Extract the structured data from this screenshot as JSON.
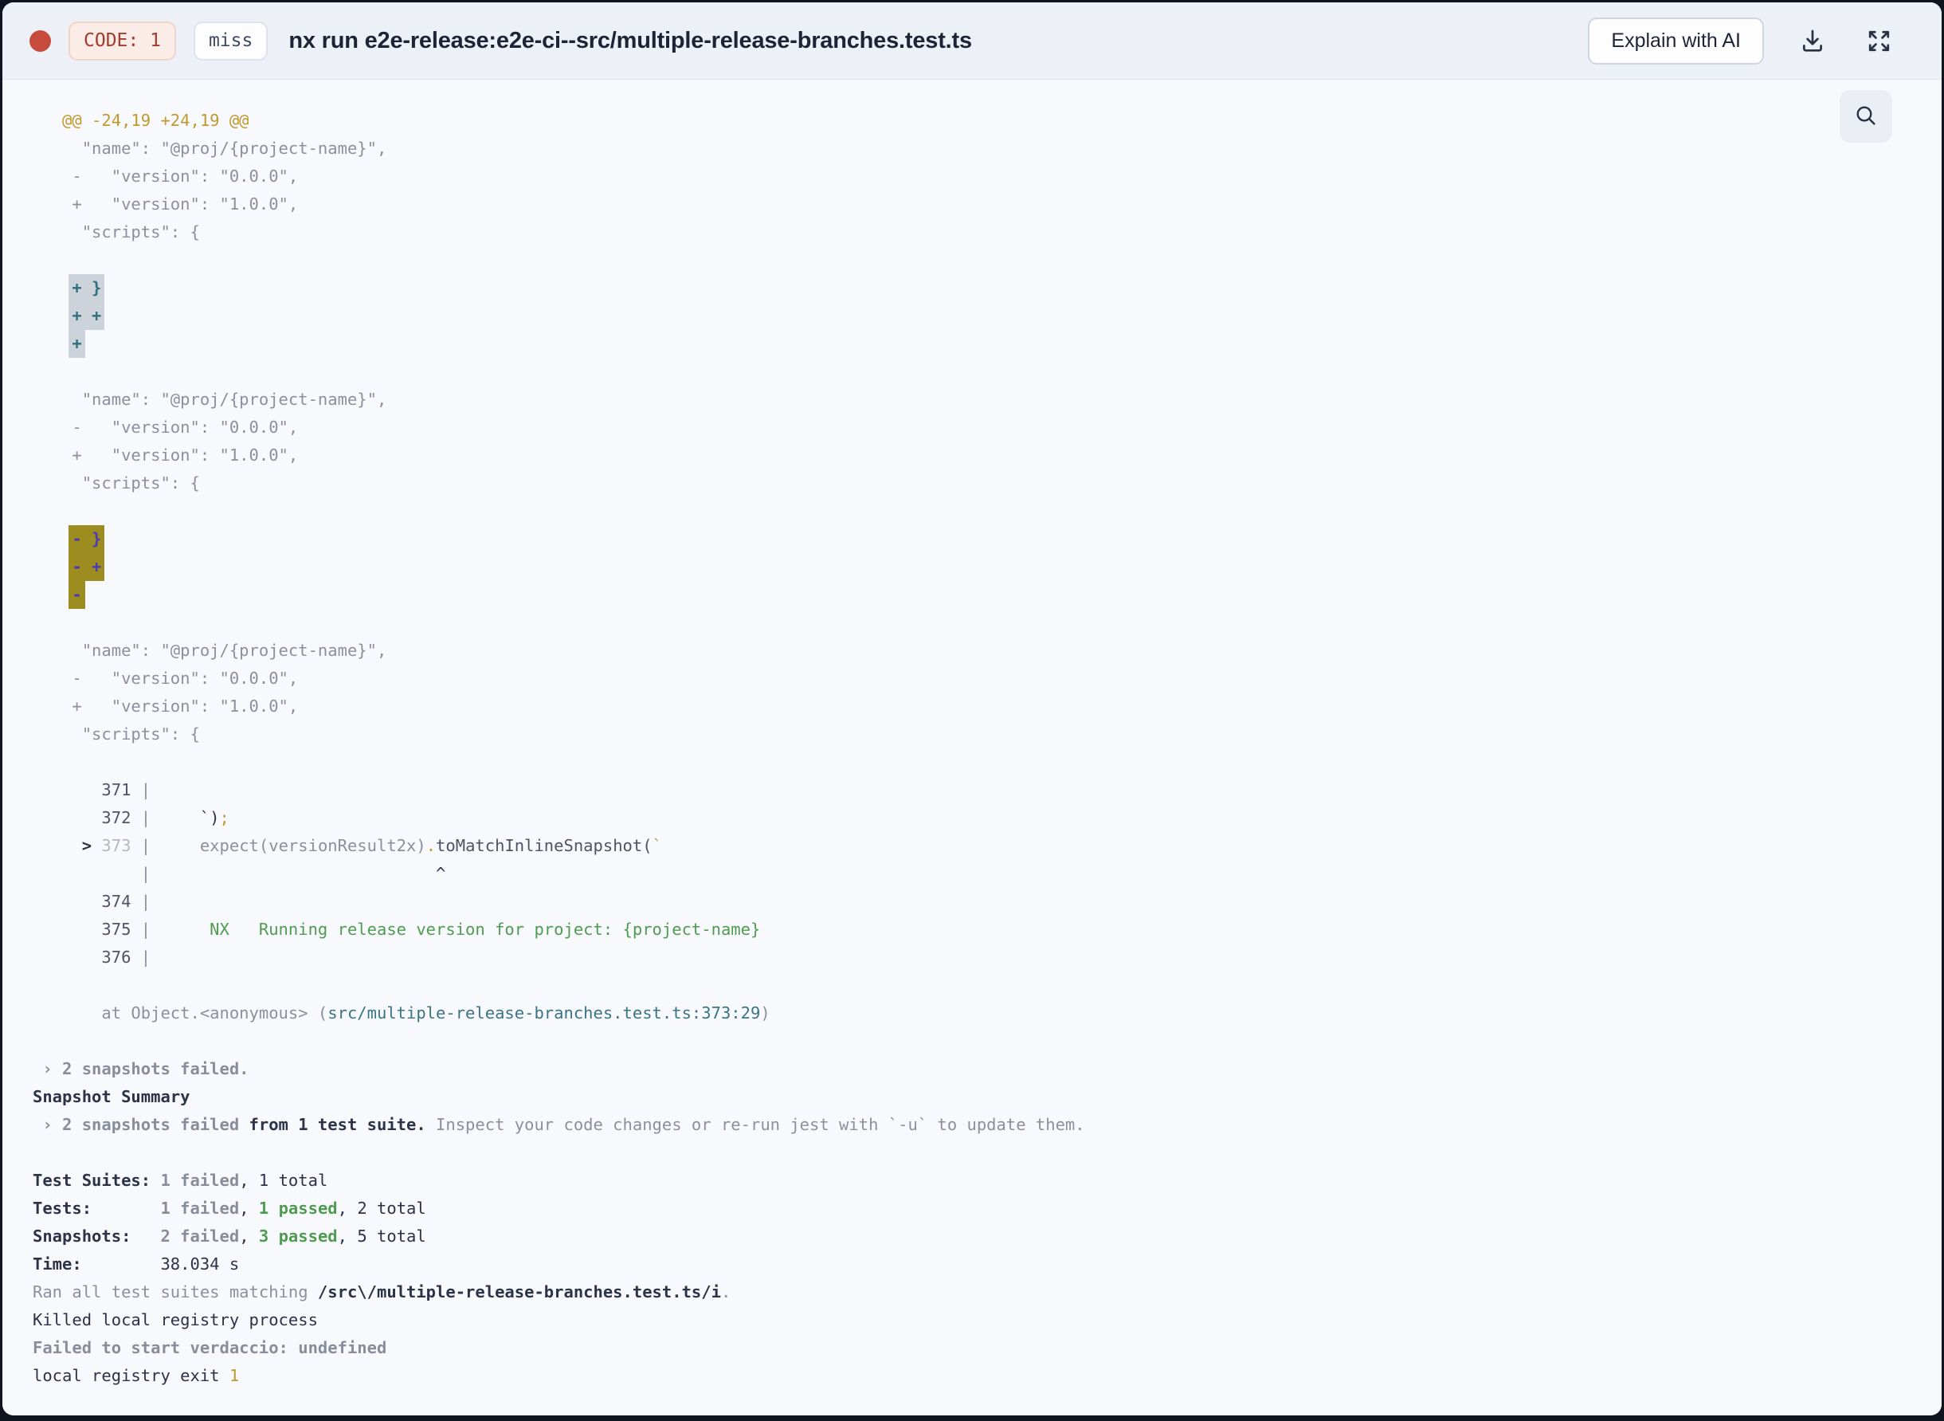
{
  "header": {
    "status_dot_color": "#c74b3c",
    "code_badge": "CODE: 1",
    "cache_badge": "miss",
    "title": "nx run e2e-release:e2e-ci--src/multiple-release-branches.test.ts",
    "explain_button": "Explain with AI",
    "icons": [
      "download-icon",
      "expand-icon"
    ]
  },
  "toolbar": {
    "search_icon": "magnifier"
  },
  "colors": {
    "header_bg": "#edf0f6",
    "log_bg": "#f8f9fc",
    "diff_context": "#8a909c",
    "diff_hunk_gold": "#c0992e",
    "added_highlight_bg": "#ccd3da",
    "added_highlight_text": "#2f6f7e",
    "removed_highlight_bg": "#9d8c20",
    "removed_highlight_text": "#4a3ab5",
    "pass_green": "#4f9b51",
    "link_teal": "#3a7386",
    "emphasis_navy": "#2c3347"
  },
  "log": {
    "lines": [
      [
        [
          "gold",
          "   @@ -24,19 +24,19 @@"
        ]
      ],
      [
        [
          "g",
          "     \"name\": \"@proj/{project-name}\","
        ]
      ],
      [
        [
          "g",
          "    -   \"version\": \"0.0.0\","
        ]
      ],
      [
        [
          "g",
          "    +   \"version\": \"1.0.0\","
        ]
      ],
      [
        [
          "g",
          "     \"scripts\": {"
        ]
      ],
      [],
      [
        [
          "sp",
          "    "
        ],
        [
          "thl",
          "+ }"
        ]
      ],
      [
        [
          "sp",
          "    "
        ],
        [
          "thl",
          "+ +"
        ]
      ],
      [
        [
          "sp",
          "    "
        ],
        [
          "thl",
          "+"
        ]
      ],
      [],
      [
        [
          "g",
          "     \"name\": \"@proj/{project-name}\","
        ]
      ],
      [
        [
          "g",
          "    -   \"version\": \"0.0.0\","
        ]
      ],
      [
        [
          "g",
          "    +   \"version\": \"1.0.0\","
        ]
      ],
      [
        [
          "g",
          "     \"scripts\": {"
        ]
      ],
      [],
      [
        [
          "sp",
          "    "
        ],
        [
          "ohl",
          "- }"
        ]
      ],
      [
        [
          "sp",
          "    "
        ],
        [
          "ohl",
          "- +"
        ]
      ],
      [
        [
          "sp",
          "    "
        ],
        [
          "ohl",
          "-"
        ]
      ],
      [],
      [
        [
          "g",
          "     \"name\": \"@proj/{project-name}\","
        ]
      ],
      [
        [
          "g",
          "    -   \"version\": \"0.0.0\","
        ]
      ],
      [
        [
          "g",
          "    +   \"version\": \"1.0.0\","
        ]
      ],
      [
        [
          "g",
          "     \"scripts\": {"
        ]
      ],
      [],
      [
        [
          "sl",
          "       371 "
        ],
        [
          "g",
          "|"
        ]
      ],
      [
        [
          "sl",
          "       372 "
        ],
        [
          "g",
          "|"
        ],
        [
          "n",
          "     `)"
        ],
        [
          "gold",
          ";"
        ]
      ],
      [
        [
          "nb",
          "     >"
        ],
        [
          "lg",
          " 373 "
        ],
        [
          "g",
          "|"
        ],
        [
          "g",
          "     expect(versionResult2x)"
        ],
        [
          "gold",
          "."
        ],
        [
          "sl",
          "toMatchInlineSnapshot("
        ],
        [
          "grnq",
          "`"
        ]
      ],
      [
        [
          "sp",
          "           "
        ],
        [
          "g",
          "|"
        ],
        [
          "n",
          "                             ^"
        ]
      ],
      [
        [
          "sl",
          "       374 "
        ],
        [
          "g",
          "|"
        ]
      ],
      [
        [
          "sl",
          "       375 "
        ],
        [
          "g",
          "|"
        ],
        [
          "grn",
          "      NX   Running release version for project: {project-name}"
        ]
      ],
      [
        [
          "sl",
          "       376 "
        ],
        [
          "g",
          "|"
        ]
      ],
      [],
      [
        [
          "g",
          "       at Object.<anonymous> ("
        ],
        [
          "lk",
          "src/multiple-release-branches.test.ts:373:29"
        ],
        [
          "g",
          ")"
        ]
      ],
      [],
      [
        [
          "gb",
          " › 2 snapshots failed."
        ]
      ],
      [
        [
          "nb",
          "Snapshot Summary"
        ]
      ],
      [
        [
          "gb",
          " › 2 snapshots failed"
        ],
        [
          "nb",
          " from 1 test suite."
        ],
        [
          "g",
          " Inspect your code changes or re-run jest with `-u` to update them."
        ]
      ],
      [],
      [
        [
          "nb",
          "Test Suites: "
        ],
        [
          "gb",
          "1 failed"
        ],
        [
          "n",
          ", 1 total"
        ]
      ],
      [
        [
          "nb",
          "Tests:       "
        ],
        [
          "gb",
          "1 failed"
        ],
        [
          "n",
          ", "
        ],
        [
          "grnb",
          "1 passed"
        ],
        [
          "n",
          ", 2 total"
        ]
      ],
      [
        [
          "nb",
          "Snapshots:   "
        ],
        [
          "gb",
          "2 failed"
        ],
        [
          "n",
          ", "
        ],
        [
          "grnb",
          "3 passed"
        ],
        [
          "n",
          ", 5 total"
        ]
      ],
      [
        [
          "nb",
          "Time:        "
        ],
        [
          "n",
          "38.034 s"
        ]
      ],
      [
        [
          "g",
          "Ran all test suites matching "
        ],
        [
          "nb",
          "/src\\/multiple-release-branches.test.ts/i"
        ],
        [
          "g",
          "."
        ]
      ],
      [
        [
          "n",
          "Killed local registry process"
        ]
      ],
      [
        [
          "gb",
          "Failed to start verdaccio: undefined"
        ]
      ],
      [
        [
          "n",
          "local registry exit "
        ],
        [
          "gold",
          "1"
        ]
      ]
    ]
  }
}
